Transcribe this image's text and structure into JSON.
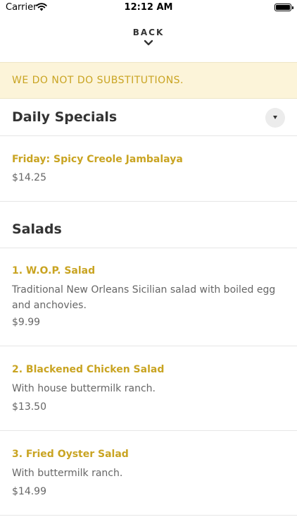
{
  "status_bar": {
    "carrier": "Carrier",
    "time": "12:12 AM",
    "battery_percent": 100
  },
  "nav": {
    "back_label": "BACK"
  },
  "notice": "WE DO NOT DO SUBSTITUTIONS.",
  "sections": [
    {
      "title": "Daily Specials",
      "items": [
        {
          "name": "Friday: Spicy Creole Jambalaya",
          "price": "$14.25"
        }
      ]
    },
    {
      "title": "Salads",
      "items": [
        {
          "name": "1. W.O.P. Salad",
          "description": "Traditional New Orleans Sicilian salad with boiled egg and anchovies.",
          "price": "$9.99"
        },
        {
          "name": "2. Blackened Chicken Salad",
          "description": "With house buttermilk ranch.",
          "price": "$13.50"
        },
        {
          "name": "3. Fried Oyster Salad",
          "description": "With buttermilk ranch.",
          "price": "$14.99"
        }
      ]
    }
  ],
  "colors": {
    "accent": "#c9a422",
    "notice_bg": "#fcf4d9",
    "text": "#333333",
    "muted": "#666666",
    "divider": "#e6e6e6"
  },
  "icons": {
    "wifi": "wifi-icon",
    "battery": "battery-icon",
    "back": "chevron-down-icon",
    "section_toggle": "triangle-down-icon"
  }
}
